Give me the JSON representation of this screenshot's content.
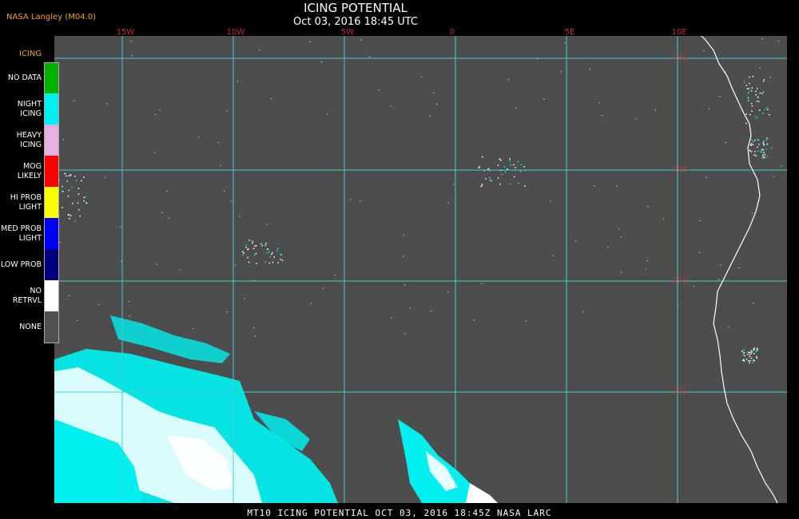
{
  "header": {
    "credit": "NASA Langley (M04.0)",
    "title": "ICING POTENTIAL",
    "subtitle": "Oct 03, 2016 18:45 UTC"
  },
  "longitude_labels": [
    "15W",
    "10W",
    "5W",
    "0",
    "5E",
    "10E"
  ],
  "latitude_labels": [
    "15S",
    "20S",
    "25S",
    "30S"
  ],
  "legend": {
    "title": "ICING",
    "items": [
      {
        "label": "NO DATA",
        "color": "#00b000"
      },
      {
        "label": "NIGHT ICING",
        "color": "#00f0f0"
      },
      {
        "label": "HEAVY ICING",
        "color": "#e8b0e0"
      },
      {
        "label": "MOG LIKELY",
        "color": "#ff0000"
      },
      {
        "label": "HI PROB LIGHT",
        "color": "#ffff00"
      },
      {
        "label": "MED PROB LIGHT",
        "color": "#0000ff"
      },
      {
        "label": "LOW PROB",
        "color": "#000080"
      },
      {
        "label": "NO RETRVL",
        "color": "#ffffff"
      },
      {
        "label": "NONE",
        "color": "#505050"
      }
    ]
  },
  "footer": "MT10   ICING POTENTIAL   OCT 03, 2016 18:45Z   NASA LARC",
  "colors": {
    "background": "#4d4d4d",
    "grid": "#40d0d8",
    "coastline": "#ffffff",
    "icing": "#00f0f0",
    "no_retrieval": "#ffffff",
    "axis_labels": "#c03030"
  }
}
